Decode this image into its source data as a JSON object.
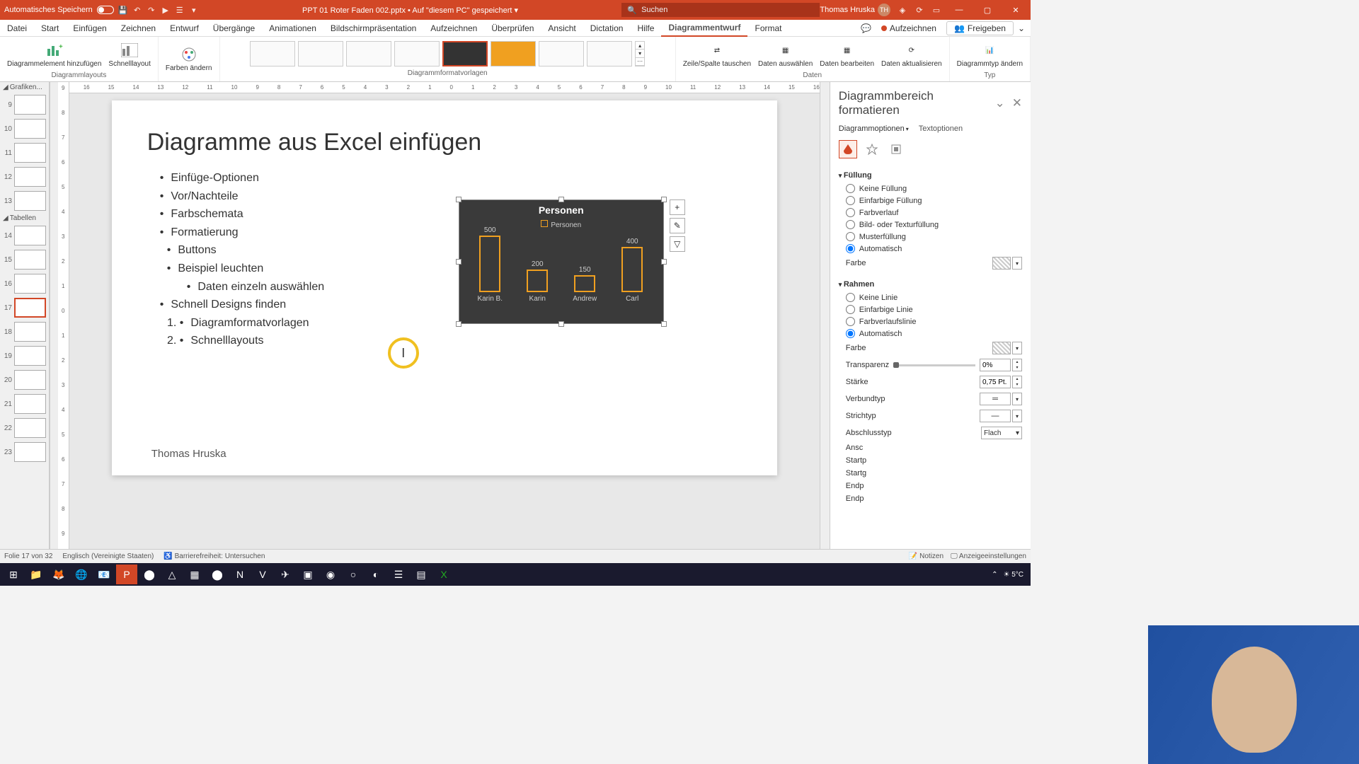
{
  "titlebar": {
    "autosave": "Automatisches Speichern",
    "filename": "PPT 01 Roter Faden 002.pptx",
    "saved_loc": "Auf \"diesem PC\" gespeichert",
    "search_placeholder": "Suchen",
    "user": "Thomas Hruska",
    "user_initials": "TH"
  },
  "menu": {
    "items": [
      "Datei",
      "Start",
      "Einfügen",
      "Zeichnen",
      "Entwurf",
      "Übergänge",
      "Animationen",
      "Bildschirmpräsentation",
      "Aufzeichnen",
      "Überprüfen",
      "Ansicht",
      "Dictation",
      "Hilfe",
      "Diagrammentwurf",
      "Format"
    ],
    "active": "Diagrammentwurf",
    "record": "Aufzeichnen",
    "share": "Freigeben"
  },
  "ribbon": {
    "layouts_group": "Diagrammlayouts",
    "add_element": "Diagrammelement hinzufügen",
    "quick_layout": "Schnelllayout",
    "colors": "Farben ändern",
    "styles_group": "Diagrammformatvorlagen",
    "data_group": "Daten",
    "swap": "Zeile/Spalte tauschen",
    "select_data": "Daten auswählen",
    "edit_data": "Daten bearbeiten",
    "refresh": "Daten aktualisieren",
    "type_group": "Typ",
    "change_type": "Diagrammtyp ändern"
  },
  "thumbs": {
    "section1": "Grafiken...",
    "section2": "Tabellen",
    "nums": [
      "9",
      "10",
      "11",
      "12",
      "13",
      "14",
      "15",
      "16",
      "17",
      "18",
      "19",
      "20",
      "21",
      "22",
      "23"
    ]
  },
  "ruler_h": [
    "16",
    "15",
    "14",
    "13",
    "12",
    "11",
    "10",
    "9",
    "8",
    "7",
    "6",
    "5",
    "4",
    "3",
    "2",
    "1",
    "0",
    "1",
    "2",
    "3",
    "4",
    "5",
    "6",
    "7",
    "8",
    "9",
    "10",
    "11",
    "12",
    "13",
    "14",
    "15",
    "16"
  ],
  "ruler_v": [
    "9",
    "8",
    "7",
    "6",
    "5",
    "4",
    "3",
    "2",
    "1",
    "0",
    "1",
    "2",
    "3",
    "4",
    "5",
    "6",
    "7",
    "8",
    "9"
  ],
  "slide": {
    "title": "Diagramme aus Excel einfügen",
    "bullets": [
      "Einfüge-Optionen",
      "Vor/Nachteile",
      "Farbschemata",
      "Formatierung"
    ],
    "sub": [
      "Buttons",
      "Beispiel leuchten"
    ],
    "sub2": [
      "Daten einzeln auswählen"
    ],
    "bullet5": "Schnell Designs finden",
    "ol": [
      "Diagramformatvorlagen",
      "Schnelllayouts"
    ],
    "footer": "Thomas Hruska",
    "highlight": "I"
  },
  "chart_data": {
    "type": "bar",
    "title": "Personen",
    "legend": "Personen",
    "categories": [
      "Karin B.",
      "Karin",
      "Andrew",
      "Carl"
    ],
    "values": [
      500,
      200,
      150,
      400
    ],
    "ylim": [
      0,
      500
    ]
  },
  "chart_side": [
    "+",
    "✎",
    "▽"
  ],
  "panel": {
    "title": "Diagrammbereich formatieren",
    "tab1": "Diagrammoptionen",
    "tab2": "Textoptionen",
    "fill_head": "Füllung",
    "fill_opts": [
      "Keine Füllung",
      "Einfarbige Füllung",
      "Farbverlauf",
      "Bild- oder Texturfüllung",
      "Musterfüllung",
      "Automatisch"
    ],
    "color_label": "Farbe",
    "border_head": "Rahmen",
    "border_opts": [
      "Keine Linie",
      "Einfarbige Linie",
      "Farbverlaufslinie",
      "Automatisch"
    ],
    "transp": "Transparenz",
    "transp_val": "0%",
    "width": "Stärke",
    "width_val": "0,75 Pt.",
    "compound": "Verbundtyp",
    "dash": "Strichtyp",
    "cap": "Abschlusstyp",
    "cap_val": "Flach",
    "join": "Ansc",
    "start_t": "Startp",
    "start_s": "Startg",
    "end_t": "Endp",
    "end_s": "Endp"
  },
  "status": {
    "slide_of": "Folie 17 von 32",
    "lang": "Englisch (Vereinigte Staaten)",
    "access": "Barrierefreiheit: Untersuchen",
    "notes": "Notizen",
    "display": "Anzeigeeinstellungen"
  },
  "taskbar": {
    "weather": "5°C"
  }
}
